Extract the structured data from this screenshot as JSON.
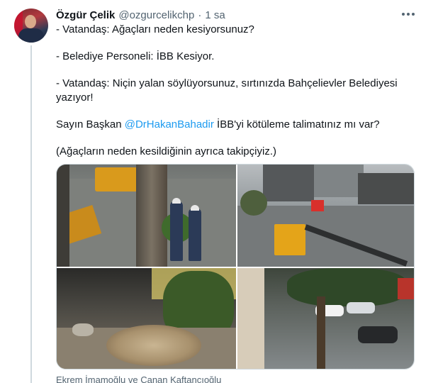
{
  "author": {
    "name": "Özgür Çelik",
    "handle": "@ozgurcelikchp",
    "separator": "·",
    "time": "1 sa"
  },
  "icons": {
    "more": "more-dots-icon",
    "avatar": "avatar-photo"
  },
  "tweet": {
    "line1": "- Vatandaş: Ağaçları neden kesiyorsunuz?",
    "line2": "- Belediye Personeli: İBB Kesiyor.",
    "line3a": "- Vatandaş: Niçin yalan söylüyorsunuz, sırtınızda Bahçelievler Belediyesi",
    "line3b": "yazıyor!",
    "line4_prefix": "Sayın Başkan ",
    "line4_mention": "@DrHakanBahadir",
    "line4_suffix": " İBB'yi kötüleme talimatınız mı var?",
    "line5": "(Ağaçların neden kesildiğinin ayrıca takipçiyiz.)"
  },
  "media_tags": "Ekrem İmamoğlu ve Canan Kaftancıoğlu",
  "colors": {
    "text": "#0f1419",
    "secondary": "#536471",
    "link": "#1d9bf0",
    "border": "#cfd9de"
  }
}
